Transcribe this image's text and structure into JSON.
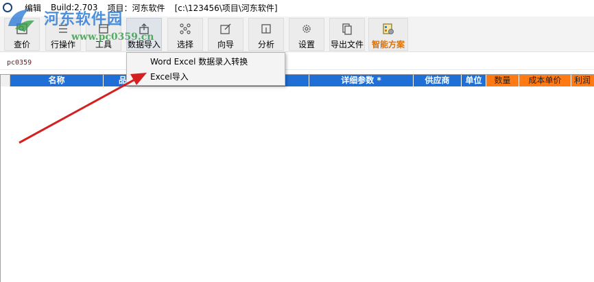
{
  "titlebar": {
    "menu_edit": "编辑",
    "build": "Build:2.703",
    "project": "项目：河东软件",
    "path": "[c:\\123456\\项目\\河东软件]"
  },
  "watermark": {
    "title": "河东软件园",
    "url": "www.pc0359.cn"
  },
  "toolbar": {
    "buttons": [
      {
        "label": "查价",
        "icon": "query-icon"
      },
      {
        "label": "行操作",
        "icon": "list-icon"
      },
      {
        "label": "工具",
        "icon": "tool-icon"
      },
      {
        "label": "数据导入",
        "icon": "import-icon"
      },
      {
        "label": "选择",
        "icon": "select-icon"
      },
      {
        "label": "向导",
        "icon": "wizard-icon"
      },
      {
        "label": "分析",
        "icon": "analyze-icon"
      },
      {
        "label": "设置",
        "icon": "gear-icon"
      },
      {
        "label": "导出文件",
        "icon": "export-icon"
      },
      {
        "label": "智能方案",
        "icon": "smart-plan-icon"
      }
    ]
  },
  "filter": {
    "value": "pc0359"
  },
  "dropdown": {
    "items": [
      "Word Excel 数据录入转换",
      "Excel导入"
    ]
  },
  "grid": {
    "columns": [
      {
        "label": "名称",
        "color": "#1f6fd6"
      },
      {
        "label": "品",
        "color": "#1f6fd6"
      },
      {
        "label": "详细参数 *",
        "color": "#1f6fd6"
      },
      {
        "label": "供应商",
        "color": "#1f6fd6"
      },
      {
        "label": "单位",
        "color": "#1f6fd6"
      },
      {
        "label": "数量",
        "color": "#ff7a12"
      },
      {
        "label": "成本单价",
        "color": "#ff7a12"
      },
      {
        "label": "利润",
        "color": "#ff7a12"
      }
    ]
  },
  "colors": {
    "header_blue": "#1f6fd6",
    "header_orange": "#ff7a12",
    "arrow_red": "#d42020",
    "smart_plan_text": "#e07000"
  }
}
